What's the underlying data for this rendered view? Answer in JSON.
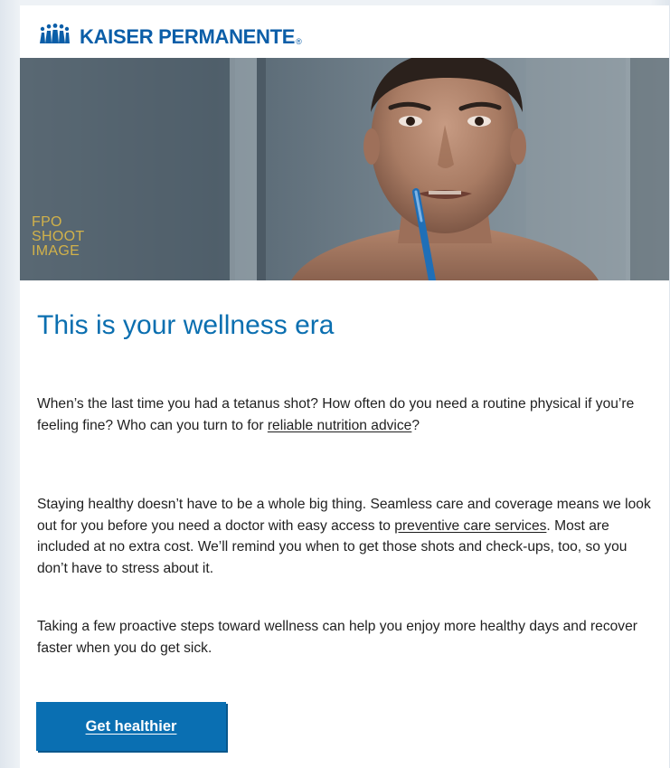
{
  "brand": {
    "name": "KAISER PERMANENTE",
    "registered_mark": "®",
    "logo_icon": "kaiser-people-icon",
    "color": "#0b5ea8"
  },
  "hero": {
    "placeholder_label": [
      "FPO",
      "SHOOT",
      "IMAGE"
    ],
    "label_color": "#d2b24a",
    "image_subject": "man-with-toothbrush"
  },
  "content": {
    "headline": "This is your wellness era",
    "headline_color": "#0b6fb0",
    "paragraph1": {
      "text_before": "When’s the last time you had a tetanus shot? How often do you need a routine physical if you’re feeling fine? Who can you turn to for ",
      "link": "reliable nutrition advice",
      "text_after": "?"
    },
    "paragraph2": {
      "text_before": "Staying healthy doesn’t have to be a whole big thing. Seamless care and coverage means we look out for you before you need a doctor with easy access to ",
      "link": "preventive care services",
      "text_after": ". Most are included at no extra cost. We’ll remind you when to get those shots and check-ups, too, so you don’t have to stress about it."
    },
    "paragraph3": "Taking a few proactive steps toward wellness can help you enjoy more healthy days and recover faster when you do get sick."
  },
  "cta": {
    "label": "Get healthier",
    "color": "#0a6fb2"
  }
}
